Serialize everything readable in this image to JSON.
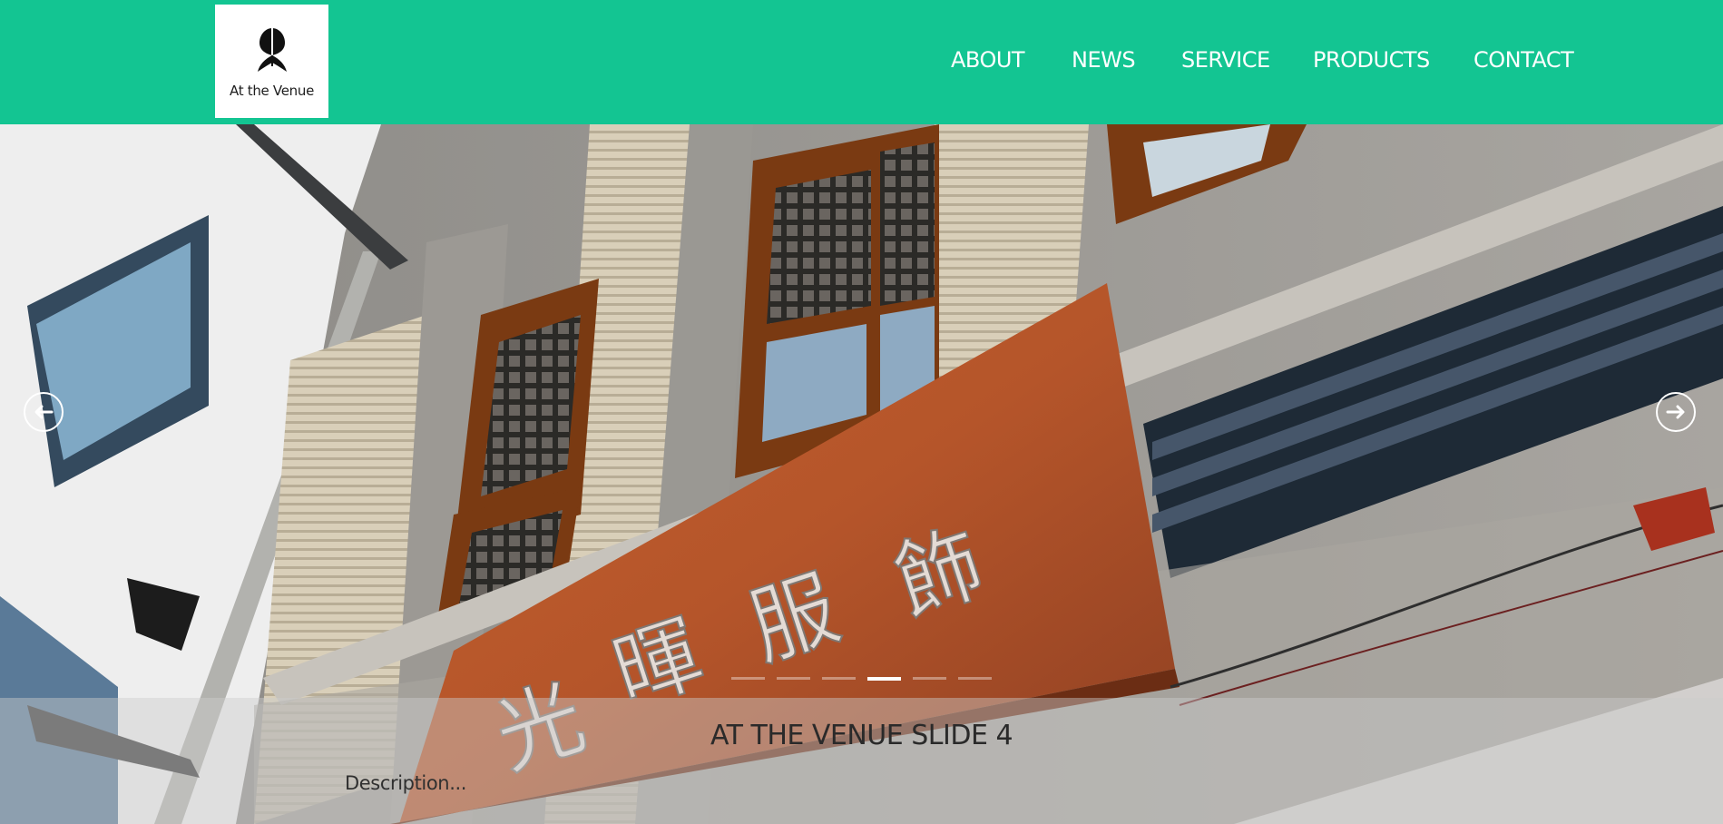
{
  "header": {
    "logo_text": "At the Venue",
    "background_color": "#13c592",
    "nav": [
      {
        "label": "ABOUT"
      },
      {
        "label": "NEWS"
      },
      {
        "label": "SERVICE"
      },
      {
        "label": "PRODUCTS"
      },
      {
        "label": "CONTACT"
      }
    ]
  },
  "slider": {
    "slide_count": 6,
    "active_slide_index": 3,
    "caption_title": "AT THE VENUE SLIDE 4",
    "caption_description": "Description...",
    "sign_text": "光暉服飾",
    "prev_icon": "arrow-left-icon",
    "next_icon": "arrow-right-icon"
  }
}
